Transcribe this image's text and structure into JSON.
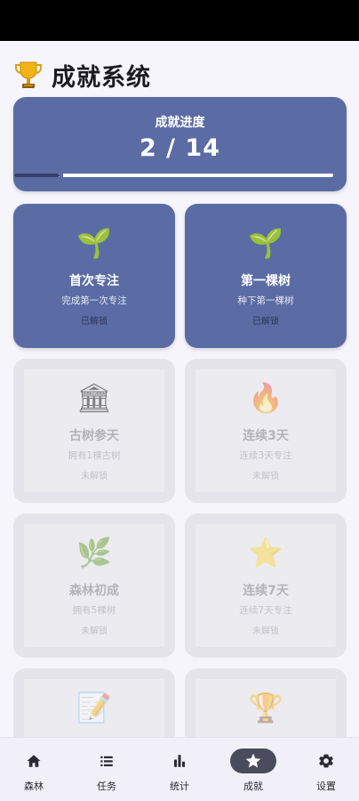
{
  "header": {
    "title": "成就系统",
    "icon": "trophy-icon"
  },
  "progress": {
    "label": "成就进度",
    "value_text": "2 / 14",
    "unlocked": 2,
    "total": 14
  },
  "achievements": [
    {
      "icon": "🌱",
      "icon_name": "seedling-icon",
      "name": "首次专注",
      "desc": "完成第一次专注",
      "status": "已解锁",
      "unlocked": true
    },
    {
      "icon": "🌱",
      "icon_name": "seedling-icon",
      "name": "第一棵树",
      "desc": "种下第一棵树",
      "status": "已解锁",
      "unlocked": true
    },
    {
      "icon": "🏛",
      "icon_name": "classical-building-icon",
      "name": "古树参天",
      "desc": "拥有1棵古树",
      "status": "未解锁",
      "unlocked": false
    },
    {
      "icon": "🔥",
      "icon_name": "fire-icon",
      "name": "连续3天",
      "desc": "连续3天专注",
      "status": "未解锁",
      "unlocked": false
    },
    {
      "icon": "🌿",
      "icon_name": "herb-icon",
      "name": "森林初成",
      "desc": "拥有5棵树",
      "status": "未解锁",
      "unlocked": false
    },
    {
      "icon": "⭐",
      "icon_name": "star-icon",
      "name": "连续7天",
      "desc": "连续7天专注",
      "status": "未解锁",
      "unlocked": false
    },
    {
      "icon": "📝",
      "icon_name": "memo-icon",
      "name": "",
      "desc": "",
      "status": "",
      "unlocked": false
    },
    {
      "icon": "🏆",
      "icon_name": "trophy-icon",
      "name": "",
      "desc": "",
      "status": "",
      "unlocked": false
    }
  ],
  "nav": {
    "items": [
      {
        "label": "森林",
        "icon": "home-icon",
        "active": false
      },
      {
        "label": "任务",
        "icon": "list-icon",
        "active": false
      },
      {
        "label": "统计",
        "icon": "bar-chart-icon",
        "active": false
      },
      {
        "label": "成就",
        "icon": "star-icon",
        "active": true
      },
      {
        "label": "设置",
        "icon": "gear-icon",
        "active": false
      }
    ]
  },
  "colors": {
    "accent": "#5b6ca4",
    "locked_card": "#ebebf0",
    "nav_active_pill": "#4a4b5c"
  }
}
